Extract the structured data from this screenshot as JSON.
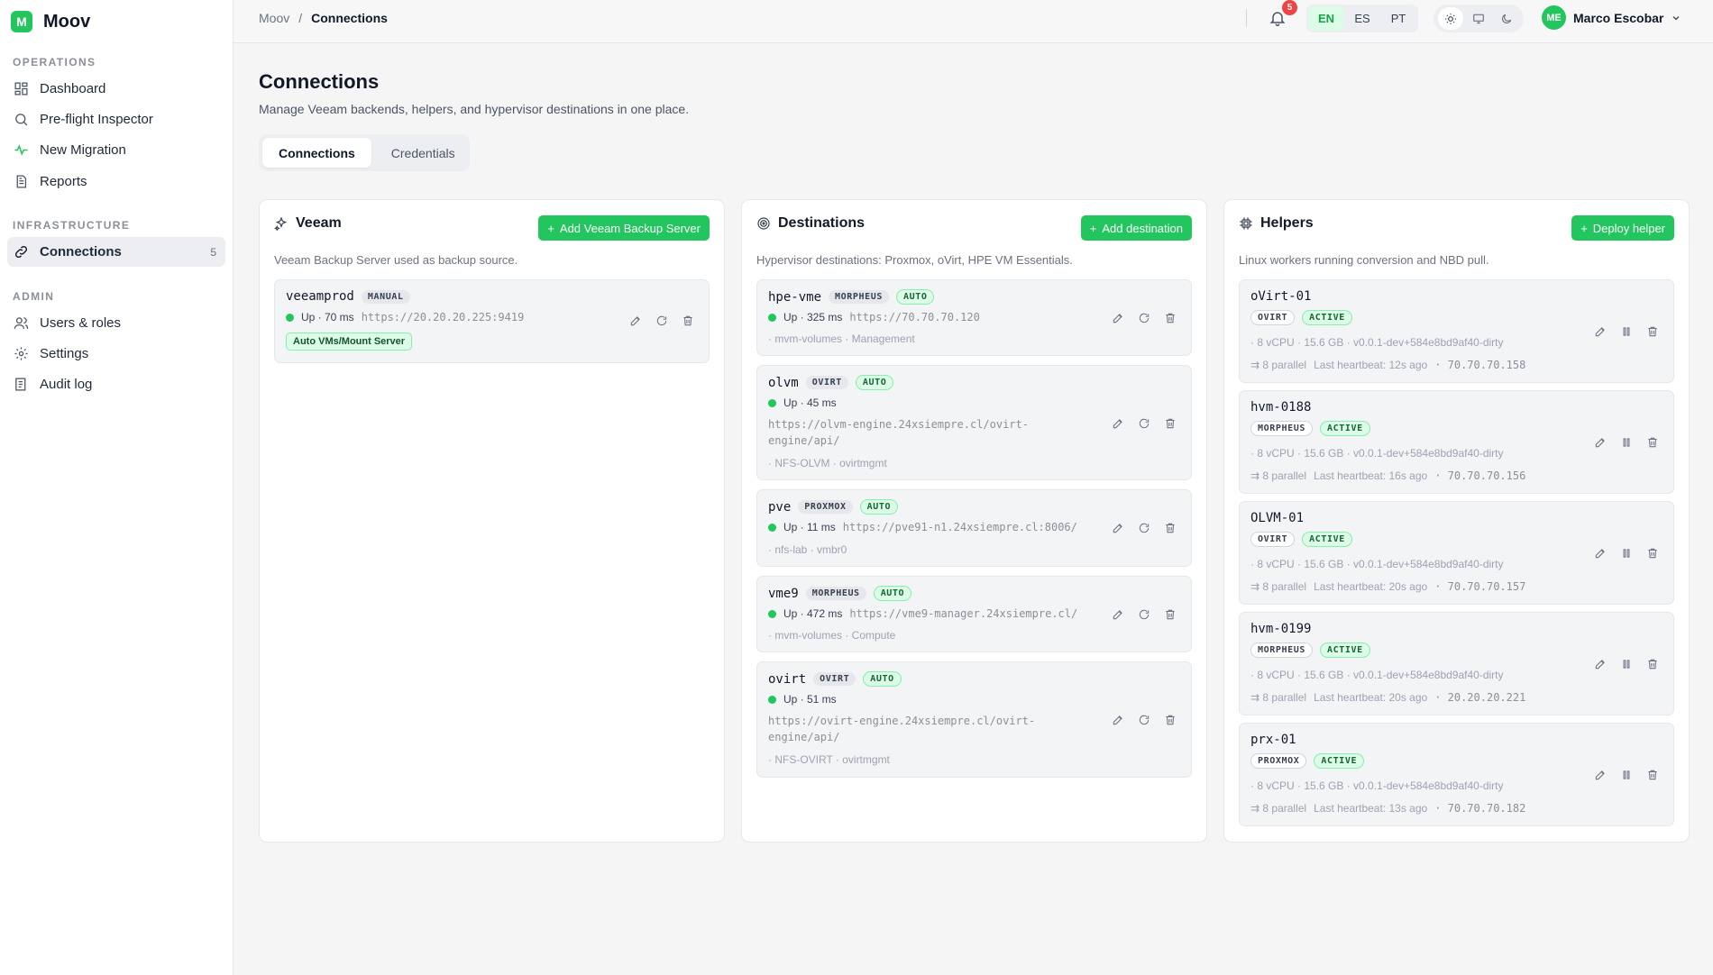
{
  "brand": {
    "logo_letter": "M",
    "name": "Moov",
    "color": "#22c55e"
  },
  "sidebar": {
    "sections": [
      {
        "title": "OPERATIONS",
        "items": [
          {
            "label": "Dashboard",
            "icon": "grid-icon"
          },
          {
            "label": "Pre-flight Inspector",
            "icon": "search-icon"
          },
          {
            "label": "New Migration",
            "icon": "activity-icon"
          },
          {
            "label": "Reports",
            "icon": "document-icon"
          }
        ]
      },
      {
        "title": "INFRASTRUCTURE",
        "items": [
          {
            "label": "Connections",
            "icon": "link-icon",
            "count": "5",
            "active": true
          }
        ]
      },
      {
        "title": "ADMIN",
        "items": [
          {
            "label": "Users & roles",
            "icon": "users-icon"
          },
          {
            "label": "Settings",
            "icon": "gear-icon"
          },
          {
            "label": "Audit log",
            "icon": "log-icon"
          }
        ]
      }
    ]
  },
  "topbar": {
    "breadcrumb": [
      "Moov",
      "/",
      "Connections"
    ],
    "notifications": "5",
    "languages": [
      "EN",
      "ES",
      "PT"
    ],
    "active_language": "EN",
    "user": {
      "initials": "ME",
      "name": "Marco Escobar"
    }
  },
  "page": {
    "title": "Connections",
    "subtitle": "Manage Veeam backends, helpers, and hypervisor destinations in one place.",
    "tabs": [
      "Connections",
      "Credentials"
    ]
  },
  "veeam": {
    "title": "Veeam",
    "button": "Add Veeam Backup Server",
    "description": "Veeam Backup Server used as backup source.",
    "servers": [
      {
        "name": "veeamprod",
        "mode": "MANUAL",
        "status": "Up · 70 ms",
        "url": "https://20.20.20.225:9419",
        "feature": "Auto VMs/Mount Server"
      }
    ]
  },
  "destinations": {
    "title": "Destinations",
    "button": "Add destination",
    "description": "Hypervisor destinations: Proxmox, oVirt, HPE VM Essentials.",
    "items": [
      {
        "name": "hpe-vme",
        "type": "MORPHEUS",
        "mode": "AUTO",
        "status": "Up · 325 ms",
        "url": "https://70.70.70.120",
        "meta": "· mvm-volumes · Management"
      },
      {
        "name": "olvm",
        "type": "OVIRT",
        "mode": "AUTO",
        "status": "Up · 45 ms",
        "url_line1": "https://olvm-engine.24xsiempre.cl/ovirt-",
        "url_line2": "engine/api/",
        "meta": "· NFS-OLVM · ovirtmgmt"
      },
      {
        "name": "pve",
        "type": "PROXMOX",
        "mode": "AUTO",
        "status": "Up · 11 ms",
        "url": "https://pve91-n1.24xsiempre.cl:8006/",
        "meta": "· nfs-lab · vmbr0"
      },
      {
        "name": "vme9",
        "type": "MORPHEUS",
        "mode": "AUTO",
        "status": "Up · 472 ms",
        "url": "https://vme9-manager.24xsiempre.cl/",
        "meta": "· mvm-volumes · Compute"
      },
      {
        "name": "ovirt",
        "type": "OVIRT",
        "mode": "AUTO",
        "status": "Up · 51 ms",
        "url_line1": "https://ovirt-engine.24xsiempre.cl/ovirt-",
        "url_line2": "engine/api/",
        "meta": "· NFS-OVIRT · ovirtmgmt"
      }
    ]
  },
  "helpers": {
    "title": "Helpers",
    "button": "Deploy helper",
    "description": "Linux workers running conversion and NBD pull.",
    "items": [
      {
        "name": "oVirt-01",
        "type": "OVIRT",
        "state": "ACTIVE",
        "specs": "· 8 vCPU · 15.6 GB · v0.0.1-dev+584e8bd9af40-dirty",
        "parallel": "⇉ 8 parallel",
        "heartbeat": "Last heartbeat: 12s ago",
        "ip": "· 70.70.70.158"
      },
      {
        "name": "hvm-0188",
        "type": "MORPHEUS",
        "state": "ACTIVE",
        "specs": "· 8 vCPU · 15.6 GB · v0.0.1-dev+584e8bd9af40-dirty",
        "parallel": "⇉ 8 parallel",
        "heartbeat": "Last heartbeat: 16s ago",
        "ip": "· 70.70.70.156"
      },
      {
        "name": "OLVM-01",
        "type": "OVIRT",
        "state": "ACTIVE",
        "specs": "· 8 vCPU · 15.6 GB · v0.0.1-dev+584e8bd9af40-dirty",
        "parallel": "⇉ 8 parallel",
        "heartbeat": "Last heartbeat: 20s ago",
        "ip": "· 70.70.70.157"
      },
      {
        "name": "hvm-0199",
        "type": "MORPHEUS",
        "state": "ACTIVE",
        "specs": "· 8 vCPU · 15.6 GB · v0.0.1-dev+584e8bd9af40-dirty",
        "parallel": "⇉ 8 parallel",
        "heartbeat": "Last heartbeat: 20s ago",
        "ip": "· 20.20.20.221"
      },
      {
        "name": "prx-01",
        "type": "PROXMOX",
        "state": "ACTIVE",
        "specs": "· 8 vCPU · 15.6 GB · v0.0.1-dev+584e8bd9af40-dirty",
        "parallel": "⇉ 8 parallel",
        "heartbeat": "Last heartbeat: 13s ago",
        "ip": "· 70.70.70.182"
      }
    ]
  }
}
